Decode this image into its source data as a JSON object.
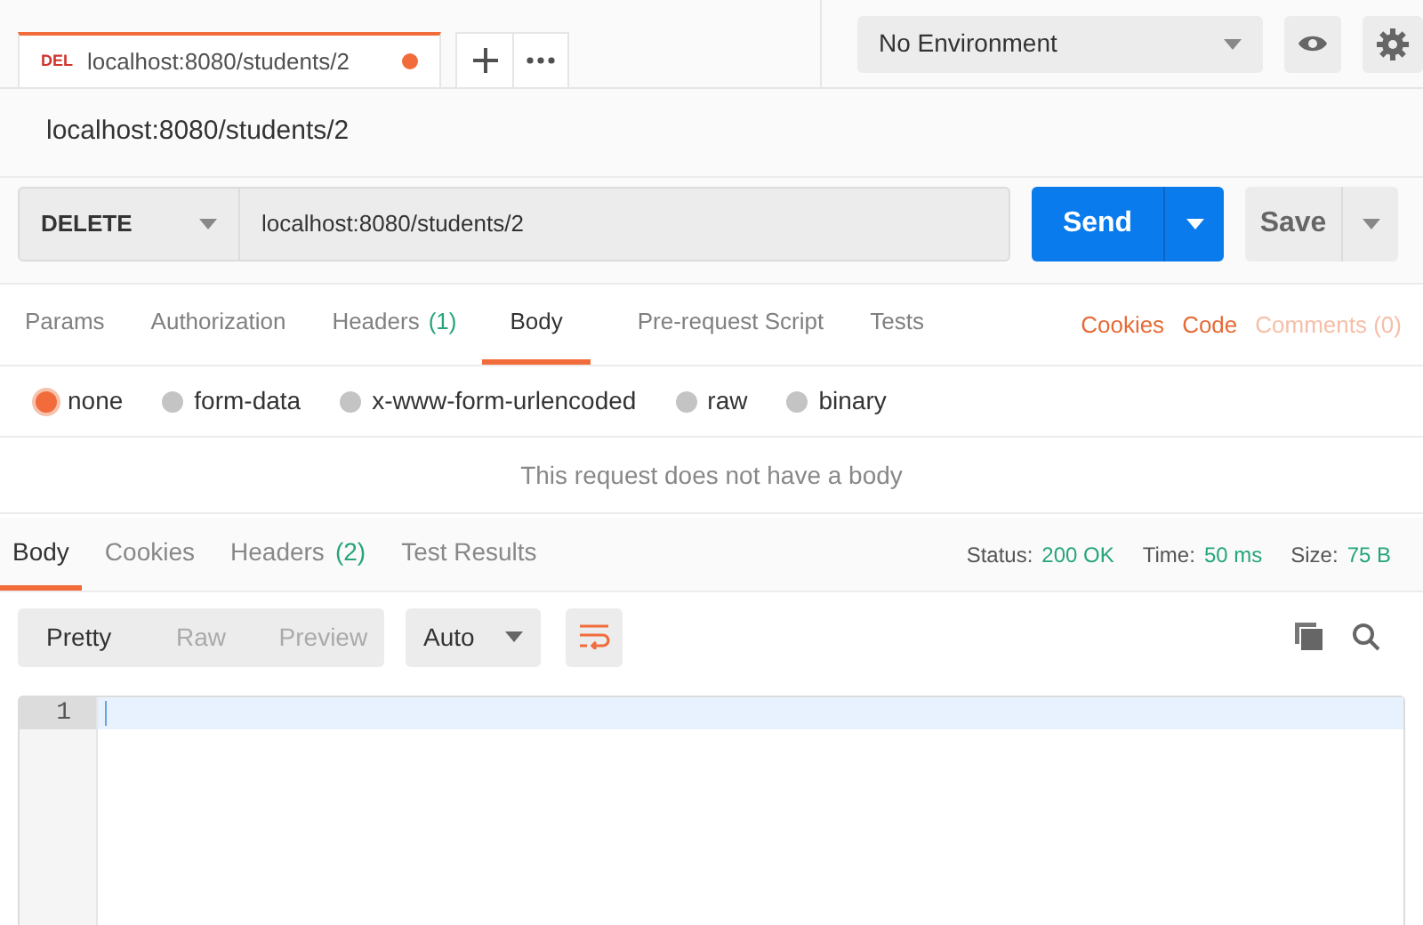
{
  "tab": {
    "method": "DEL",
    "title": "localhost:8080/students/2",
    "unsaved": true
  },
  "environment": {
    "value": "No Environment"
  },
  "request_name": "localhost:8080/students/2",
  "request": {
    "method": "DELETE",
    "url": "localhost:8080/students/2",
    "send": "Send",
    "save": "Save"
  },
  "request_tabs": [
    {
      "label": "Params",
      "selected": false
    },
    {
      "label": "Authorization",
      "selected": false
    },
    {
      "label": "Headers",
      "count": "(1)",
      "selected": false
    },
    {
      "label": "Body",
      "selected": true
    },
    {
      "label": "Pre-request Script",
      "selected": false
    },
    {
      "label": "Tests",
      "selected": false
    }
  ],
  "request_links": [
    {
      "label": "Cookies",
      "disabled": false
    },
    {
      "label": "Code",
      "disabled": false
    },
    {
      "label": "Comments (0)",
      "disabled": true
    }
  ],
  "body_types": [
    {
      "label": "none",
      "selected": true
    },
    {
      "label": "form-data",
      "selected": false
    },
    {
      "label": "x-www-form-urlencoded",
      "selected": false
    },
    {
      "label": "raw",
      "selected": false
    },
    {
      "label": "binary",
      "selected": false
    }
  ],
  "body_message": "This request does not have a body",
  "response_tabs": [
    {
      "label": "Body",
      "selected": true
    },
    {
      "label": "Cookies",
      "selected": false
    },
    {
      "label": "Headers",
      "count": "(2)",
      "selected": false
    },
    {
      "label": "Test Results",
      "selected": false
    }
  ],
  "response_stats": [
    {
      "label": "Status:",
      "value": "200 OK"
    },
    {
      "label": "Time:",
      "value": "50 ms"
    },
    {
      "label": "Size:",
      "value": "75 B"
    }
  ],
  "view_modes": [
    {
      "label": "Pretty",
      "selected": true
    },
    {
      "label": "Raw",
      "selected": false
    },
    {
      "label": "Preview",
      "selected": false
    }
  ],
  "format": "Auto",
  "line_numbers": [
    "1"
  ]
}
